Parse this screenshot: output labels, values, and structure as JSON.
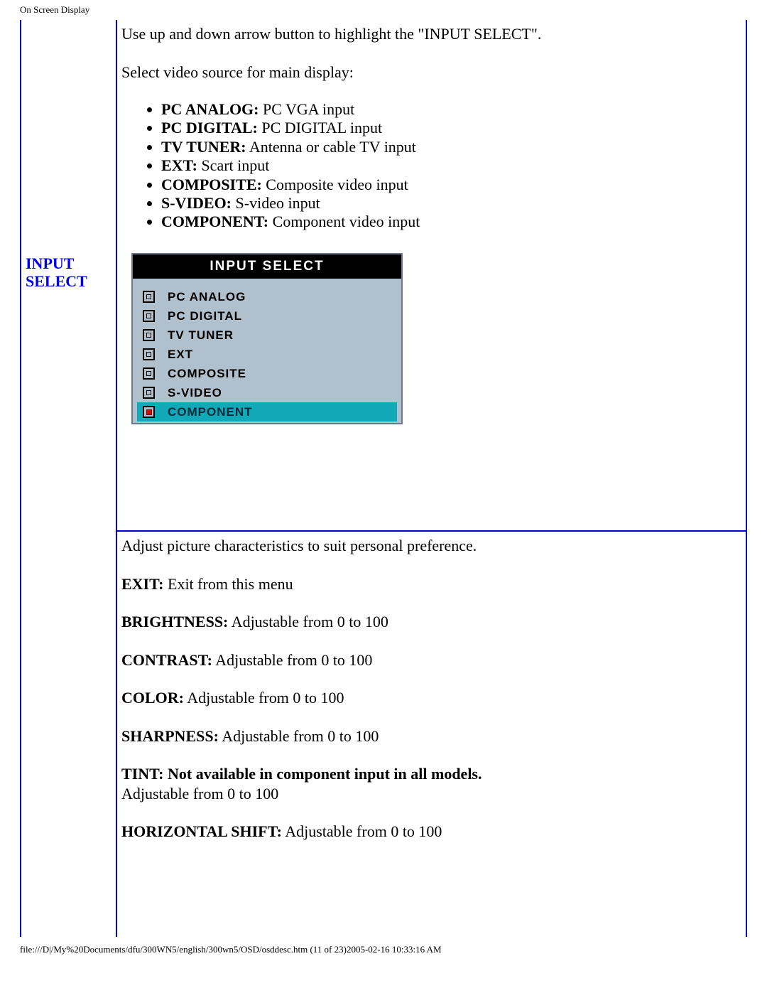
{
  "page_title": "On Screen Display",
  "footer_text": "file:///D|/My%20Documents/dfu/300WN5/english/300wn5/OSD/osddesc.htm (11 of 23)2005-02-16 10:33:16 AM",
  "left_label": "INPUT SELECT",
  "input_select": {
    "intro1": "Use up and down arrow button to highlight the \"INPUT SELECT\".",
    "intro2": "Select video source for main display:",
    "options": [
      {
        "name": "PC ANALOG:",
        "desc": " PC VGA input"
      },
      {
        "name": "PC DIGITAL:",
        "desc": " PC DIGITAL input"
      },
      {
        "name": "TV TUNER:",
        "desc": " Antenna or cable TV input"
      },
      {
        "name": "EXT:",
        "desc": " Scart input"
      },
      {
        "name": "COMPOSITE:",
        "desc": " Composite video input"
      },
      {
        "name": "S-VIDEO:",
        "desc": " S-video input"
      },
      {
        "name": "COMPONENT:",
        "desc": " Component video input"
      }
    ],
    "osd": {
      "title": "INPUT SELECT",
      "items": [
        {
          "label": "PC ANALOG",
          "selected": false
        },
        {
          "label": "PC DIGITAL",
          "selected": false
        },
        {
          "label": "TV TUNER",
          "selected": false
        },
        {
          "label": "EXT",
          "selected": false
        },
        {
          "label": "COMPOSITE",
          "selected": false
        },
        {
          "label": "S-VIDEO",
          "selected": false
        },
        {
          "label": "COMPONENT",
          "selected": true
        }
      ]
    }
  },
  "picture": {
    "intro": "Adjust picture characteristics to suit personal preference.",
    "rows": [
      {
        "name": "EXIT:",
        "desc": " Exit from this menu"
      },
      {
        "name": "BRIGHTNESS:",
        "desc": " Adjustable from 0 to 100"
      },
      {
        "name": "CONTRAST:",
        "desc": " Adjustable from 0 to 100"
      },
      {
        "name": "COLOR:",
        "desc": " Adjustable from 0 to 100"
      },
      {
        "name": "SHARPNESS:",
        "desc": " Adjustable from 0 to 100"
      }
    ],
    "tint_name": "TINT: Not available in component input in all models.",
    "tint_desc": "Adjustable from 0 to 100",
    "hshift_name": "HORIZONTAL SHIFT:",
    "hshift_desc": " Adjustable from 0 to 100"
  }
}
